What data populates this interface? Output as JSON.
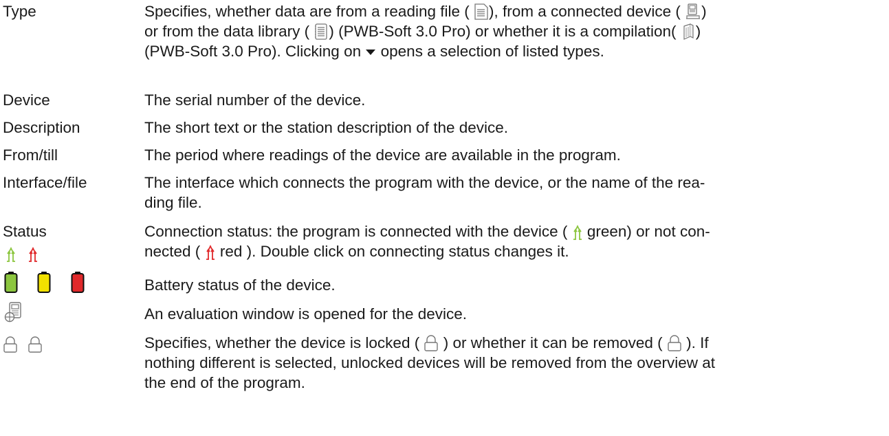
{
  "rows": {
    "type": {
      "term": "Type",
      "desc_1": "Specifies, whether data are from a reading file (",
      "desc_2": "), from a connected device (",
      "desc_3": ")",
      "desc_4": "or from the data library (",
      "desc_5": ") (PWB-Soft 3.0 Pro) or whether it is a compilation(",
      "desc_6": ")",
      "desc_7": "(PWB-Soft 3.0 Pro). Clicking on",
      "desc_8": "opens a selection of listed types."
    },
    "device": {
      "term": "Device",
      "desc": "The serial number of the device."
    },
    "description": {
      "term": "Description",
      "desc": "The short text or the station description of the device."
    },
    "from_till": {
      "term": "From/till",
      "desc": "The period where readings of the device are available in the program."
    },
    "interface_file": {
      "term": "Interface/file",
      "desc_line1": "The interface which connects the program with the device, or the name of the rea-",
      "desc_line2": "ding file."
    },
    "status": {
      "term": "Status",
      "desc_1": "Connection status: the program is connected with the device (",
      "desc_2": "green) or not con-",
      "desc_3": "nected (",
      "desc_4": "red ). Double click on connecting status changes it."
    },
    "battery": {
      "desc": "Battery status of the device."
    },
    "evaluation": {
      "desc": "An evaluation window is opened for the device."
    },
    "lock": {
      "desc_1": "Specifies, whether the device is locked (",
      "desc_2": ") or whether it can be removed (",
      "desc_3": "). If",
      "desc_line2": "nothing different is selected, unlocked devices will be removed from the overview at",
      "desc_line3": "the end of the program."
    }
  },
  "icons": {
    "reading_file": "reading-file-icon",
    "connected_device": "connected-device-icon",
    "data_library": "data-library-icon",
    "compilation": "compilation-icon",
    "dropdown": "dropdown-triangle-icon",
    "connected": "connection-green-icon",
    "disconnected": "connection-red-icon",
    "battery_full": "battery-green-icon",
    "battery_medium": "battery-yellow-icon",
    "battery_low": "battery-red-icon",
    "evaluation": "evaluation-window-icon",
    "lock": "lock-icon"
  },
  "colors": {
    "text": "#1a1a1a",
    "green": "#8cc63f",
    "yellow": "#f2e100",
    "red": "#e0292b",
    "icon_gray": "#777777"
  }
}
